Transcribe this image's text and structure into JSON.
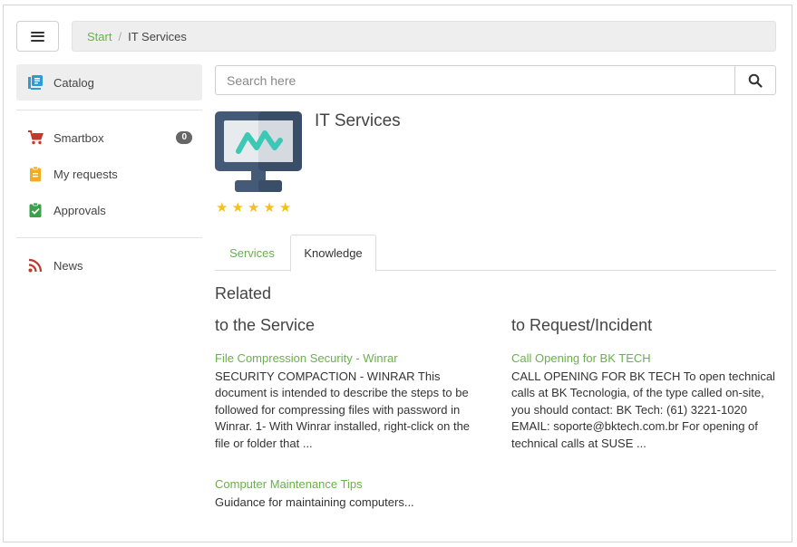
{
  "breadcrumb": {
    "start": "Start",
    "separator": "/",
    "current": "IT Services"
  },
  "sidebar": {
    "items": [
      {
        "label": "Catalog",
        "icon": "catalog-icon",
        "color": "#2f9bd5"
      },
      {
        "label": "Smartbox",
        "icon": "cart-icon",
        "color": "#c0392b",
        "badge": "0"
      },
      {
        "label": "My requests",
        "icon": "clipboard-icon",
        "color": "#f0ad1e"
      },
      {
        "label": "Approvals",
        "icon": "check-clipboard-icon",
        "color": "#3aa14a"
      },
      {
        "label": "News",
        "icon": "rss-icon",
        "color": "#c0392b"
      }
    ]
  },
  "search": {
    "placeholder": "Search here",
    "value": ""
  },
  "service": {
    "title": "IT Services",
    "rating": 5,
    "max_rating": 5
  },
  "tabs": [
    {
      "label": "Services",
      "active": false
    },
    {
      "label": "Knowledge",
      "active": true
    }
  ],
  "related": {
    "heading": "Related",
    "service_column": {
      "title": "to the Service",
      "articles": [
        {
          "title": "File Compression Security - Winrar",
          "excerpt": "SECURITY COMPACTION - WINRAR This document is intended to describe the steps to be followed for compressing files with password in Winrar. 1- With Winrar installed, right-click on the file or folder that ..."
        },
        {
          "title": "Computer Maintenance Tips",
          "excerpt": "Guidance for maintaining computers..."
        }
      ]
    },
    "incident_column": {
      "title": "to Request/Incident",
      "articles": [
        {
          "title": "Call Opening for BK TECH",
          "excerpt": "CALL OPENING FOR BK TECH To open technical calls at BK Tecnologia, of the type called on-site, you should contact: BK Tech: (61) 3221-1020 EMAIL: soporte@bktech.com.br For opening of technical calls at SUSE ..."
        }
      ]
    }
  },
  "colors": {
    "accent": "#6ab04c",
    "star": "#f4c01e"
  }
}
